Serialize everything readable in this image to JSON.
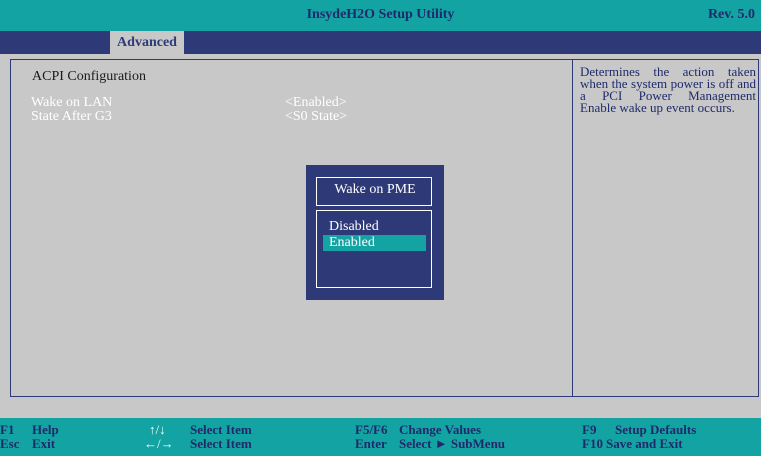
{
  "header": {
    "title": "InsydeH2O Setup Utility",
    "revision": "Rev. 5.0"
  },
  "menu": {
    "active_tab": "Advanced"
  },
  "section": {
    "title": "ACPI Configuration"
  },
  "settings": [
    {
      "label": "Wake on LAN",
      "value": "<Enabled>"
    },
    {
      "label": "State After G3",
      "value": "<S0 State>"
    }
  ],
  "help_text": "Determines the action taken when the system power is off and a PCI Power Management Enable wake up event occurs.",
  "popup": {
    "title": "Wake on PME",
    "options": [
      "Disabled",
      "Enabled"
    ],
    "selected": "Enabled"
  },
  "footer": {
    "col1": [
      {
        "key": "F1",
        "label": "Help"
      },
      {
        "key": "Esc",
        "label": "Exit"
      }
    ],
    "col2": [
      {
        "key": "↑/↓",
        "label": "Select Item"
      },
      {
        "key": "←/→",
        "label": "Select Item"
      }
    ],
    "col3": [
      {
        "key": "F5/F6",
        "label": "Change Values"
      },
      {
        "key": "Enter",
        "label": "Select ► SubMenu"
      }
    ],
    "col4": [
      {
        "key": "F9",
        "label": "Setup Defaults"
      },
      {
        "key": "F10",
        "label": "Save and Exit"
      }
    ]
  },
  "colors": {
    "teal": "#14a3a3",
    "navy": "#2e3a78",
    "panel": "#c8c8c8",
    "text_navy": "#1f2a6b"
  }
}
